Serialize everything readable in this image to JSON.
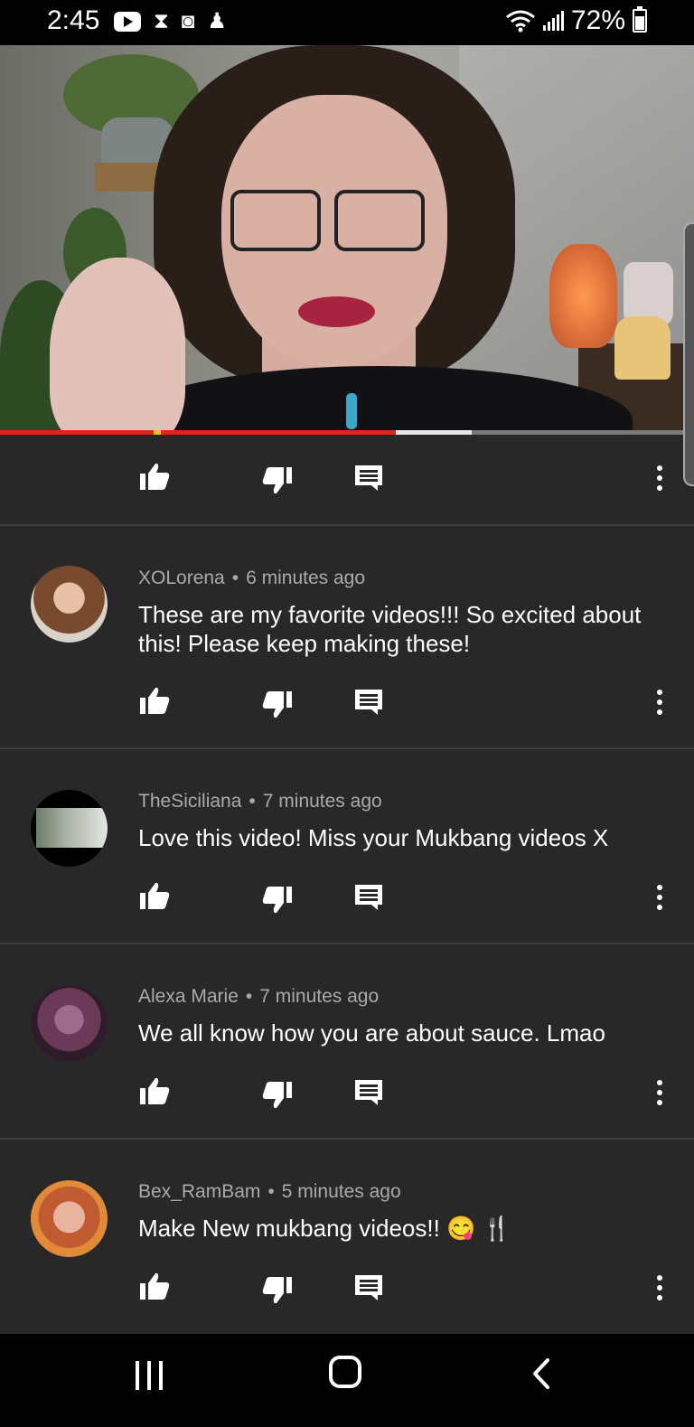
{
  "status_bar": {
    "time": "2:45",
    "battery_percent": "72%",
    "icons": [
      "youtube-icon",
      "hourglass-icon",
      "clock-app-icon",
      "notification-icon",
      "wifi-icon",
      "signal-icon",
      "battery-icon"
    ]
  },
  "video": {
    "progress_fraction": 0.57,
    "buffered_fraction": 0.68
  },
  "comments": [
    {
      "author": "XOLorena",
      "separator": "•",
      "time": "6 minutes ago",
      "text": "These are my favorite videos!!! So excited about this! Please keep making these!"
    },
    {
      "author": "TheSiciliana",
      "separator": "•",
      "time": "7 minutes ago",
      "text": "Love this video! Miss your Mukbang videos X"
    },
    {
      "author": "Alexa Marie",
      "separator": "•",
      "time": "7 minutes ago",
      "text": "We all know how you are about sauce. Lmao"
    },
    {
      "author": "Bex_RamBam",
      "separator": "•",
      "time": "5 minutes ago",
      "text": "Make New mukbang videos!! 😋 🍴"
    }
  ],
  "colors": {
    "background": "#282828",
    "progress": "#e62117",
    "meta_text": "#aaaaaa"
  }
}
